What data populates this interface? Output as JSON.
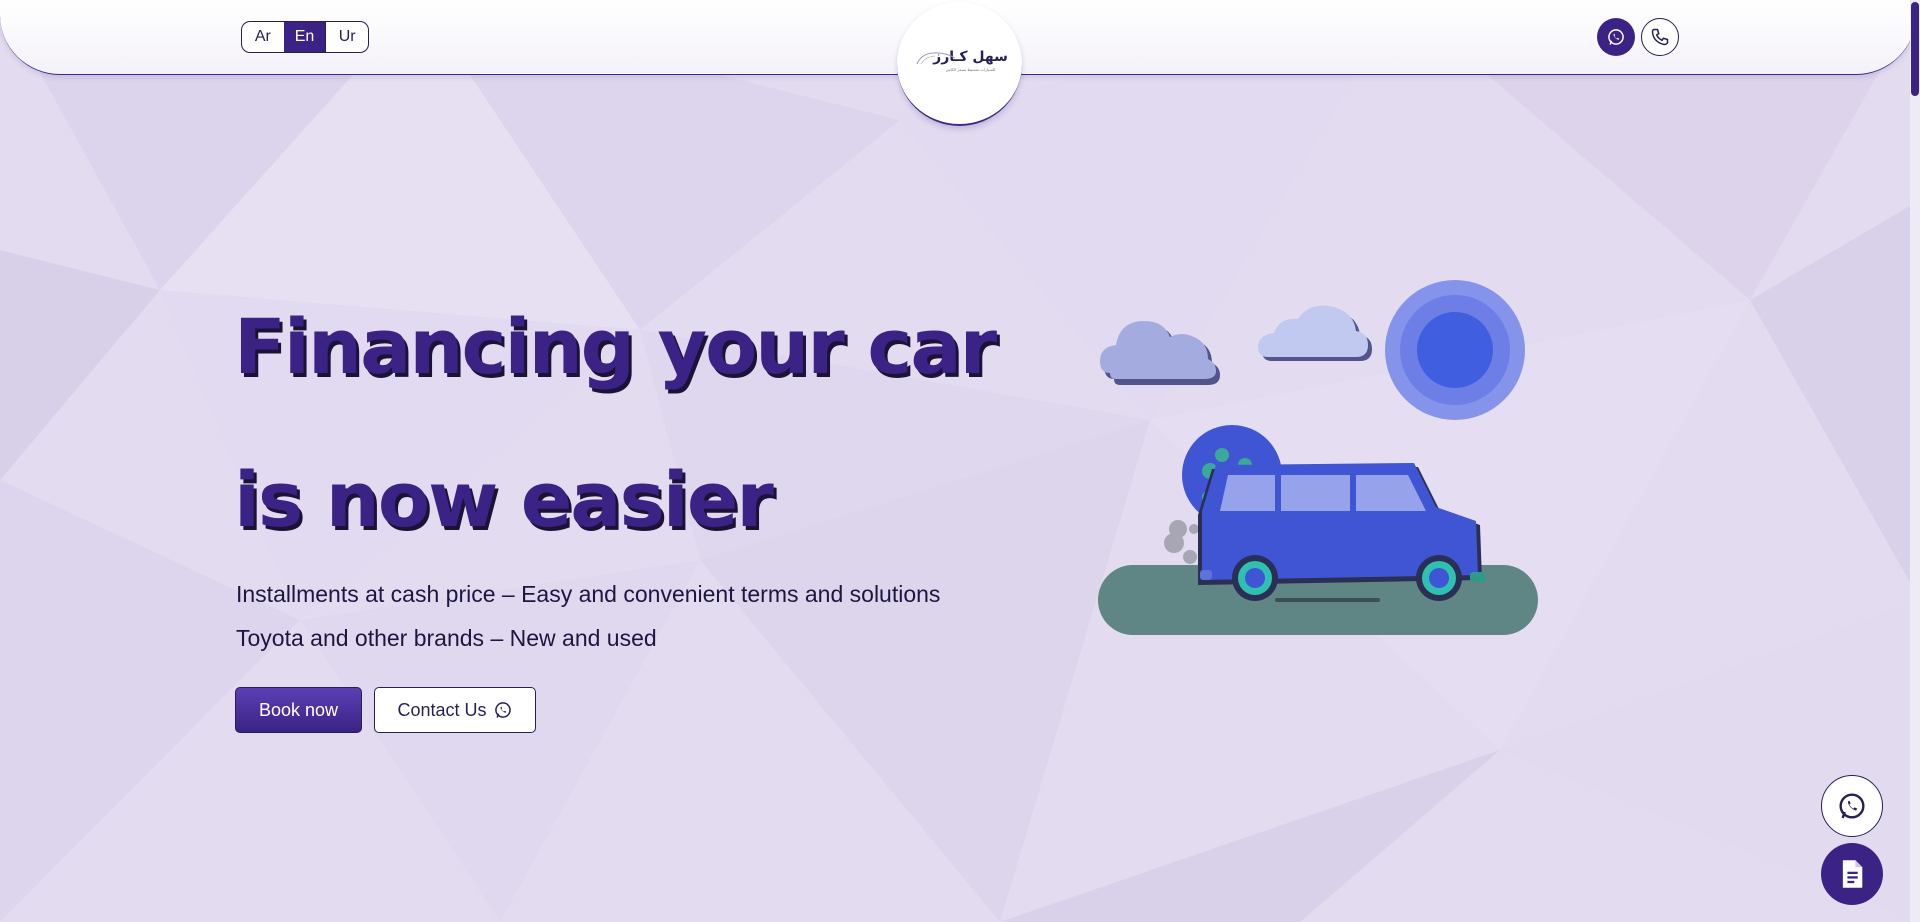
{
  "header": {
    "languages": [
      {
        "label": "Ar",
        "active": false
      },
      {
        "label": "En",
        "active": true
      },
      {
        "label": "Ur",
        "active": false
      }
    ],
    "logo_text": "سهل كـارز",
    "logo_subtext": "للسيارات تقسيط بسعر الكاش",
    "icons": [
      "whatsapp-icon",
      "phone-icon"
    ]
  },
  "hero": {
    "title_line1": "Financing your car",
    "title_line2": "is now easier",
    "subtitle_line1": "Installments at cash price – Easy and convenient terms and solutions",
    "subtitle_line2": "Toyota and other brands – New and used",
    "book_label": "Book now",
    "contact_label": "Contact Us"
  },
  "floating": {
    "icons": [
      "whatsapp-icon",
      "document-icon"
    ]
  },
  "colors": {
    "primary": "#3a2384",
    "background": "#e3dcf0",
    "car": "#3f55d4",
    "road": "#5f8585"
  }
}
